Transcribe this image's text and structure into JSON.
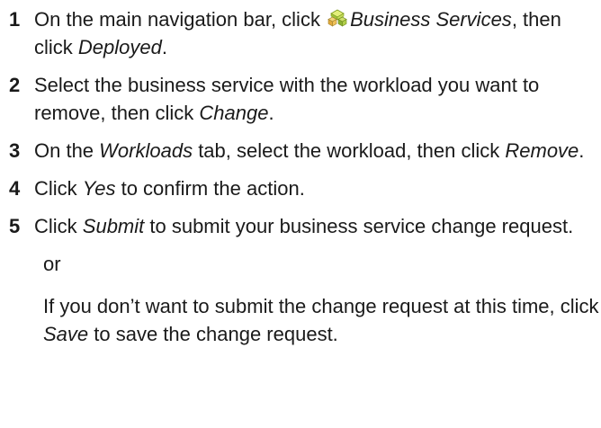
{
  "steps": [
    {
      "number": "1",
      "parts": {
        "a": "On the main navigation bar, click ",
        "icon": "business-services-icon",
        "b": "Business Services",
        "c": ", then click ",
        "d": "Deployed",
        "e": "."
      }
    },
    {
      "number": "2",
      "parts": {
        "a": "Select the business service with the workload you want to remove, then click ",
        "b": "Change",
        "c": "."
      }
    },
    {
      "number": "3",
      "parts": {
        "a": "On the ",
        "b": "Workloads",
        "c": " tab, select the workload, then click ",
        "d": "Remove",
        "e": "."
      }
    },
    {
      "number": "4",
      "parts": {
        "a": "Click ",
        "b": "Yes",
        "c": " to confirm the action."
      }
    },
    {
      "number": "5",
      "parts": {
        "a": "Click ",
        "b": "Submit",
        "c": " to submit your business service change request."
      }
    }
  ],
  "or_text": "or",
  "alternative": {
    "a": "If you don’t want to submit the change request at this time, click ",
    "b": "Save",
    "c": " to save the change request."
  }
}
